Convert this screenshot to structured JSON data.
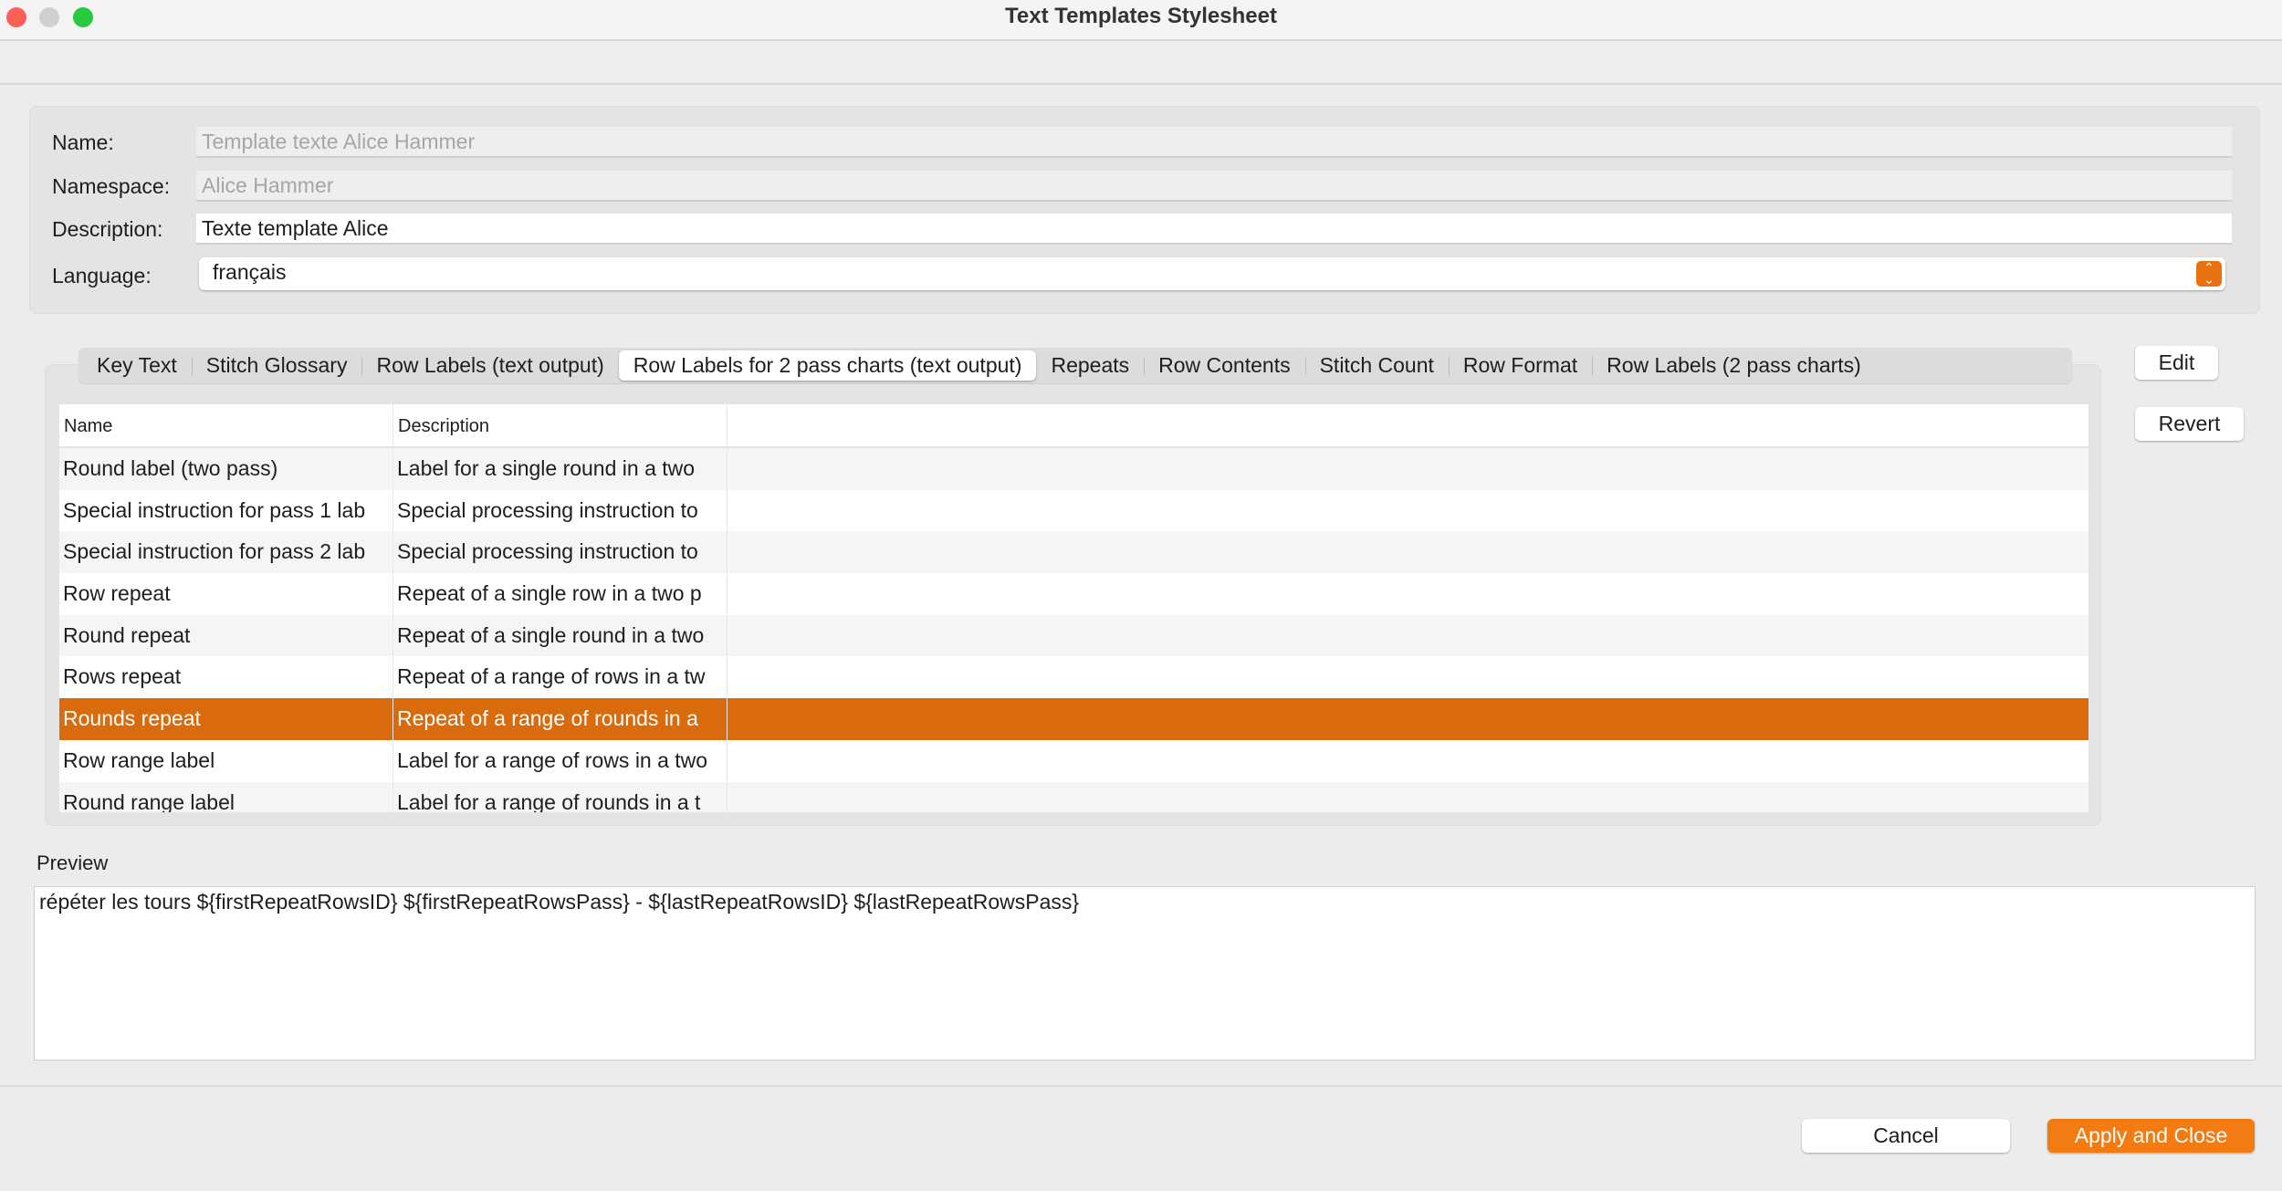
{
  "window": {
    "title": "Text Templates Stylesheet"
  },
  "form": {
    "name_label": "Name:",
    "name_value": "Template texte Alice Hammer",
    "namespace_label": "Namespace:",
    "namespace_value": "Alice Hammer",
    "description_label": "Description:",
    "description_value": "Texte template Alice",
    "language_label": "Language:",
    "language_value": "français"
  },
  "tabs": [
    {
      "label": "Key Text"
    },
    {
      "label": "Stitch Glossary"
    },
    {
      "label": "Row Labels (text output)"
    },
    {
      "label": "Row Labels for 2 pass charts (text output)",
      "active": true
    },
    {
      "label": "Repeats"
    },
    {
      "label": "Row Contents"
    },
    {
      "label": "Stitch Count"
    },
    {
      "label": "Row Format"
    },
    {
      "label": "Row Labels (2 pass charts)"
    }
  ],
  "side_buttons": {
    "edit": "Edit",
    "revert": "Revert"
  },
  "table": {
    "columns": [
      "Name",
      "Description"
    ],
    "rows": [
      [
        "Round label (two pass)",
        "Label for a single round in a two"
      ],
      [
        "Special instruction for pass 1 lab",
        "Special processing instruction to"
      ],
      [
        "Special instruction for pass 2 lab",
        "Special processing instruction to"
      ],
      [
        "Row repeat",
        "Repeat of a single row in a two p"
      ],
      [
        "Round repeat",
        "Repeat of a single round in a two"
      ],
      [
        "Rows repeat",
        "Repeat of a range of rows in a tw"
      ],
      [
        "Rounds repeat",
        "Repeat of a range of rounds in a"
      ],
      [
        "Row range label",
        "Label for a range of rows in a two"
      ],
      [
        "Round range label",
        "Label for a range of rounds in a t"
      ]
    ],
    "selected_index": 6
  },
  "preview": {
    "label": "Preview",
    "text": "répéter les tours ${firstRepeatRowsID} ${firstRepeatRowsPass} - ${lastRepeatRowsID} ${lastRepeatRowsPass}"
  },
  "footer": {
    "cancel": "Cancel",
    "apply": "Apply and Close"
  },
  "colors": {
    "accent": "#d96b0d",
    "apply_button": "#f47a12"
  }
}
